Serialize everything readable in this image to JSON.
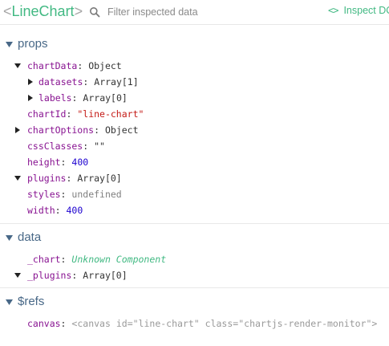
{
  "header": {
    "component_open": "<",
    "component_name": "LineChart",
    "component_close": ">",
    "search_placeholder": "Filter inspected data",
    "inspect_icon": "<>",
    "inspect_label": "Inspect DO"
  },
  "props": {
    "title": "props",
    "rows": {
      "chartData": {
        "key": "chartData",
        "value": "Object"
      },
      "datasets": {
        "key": "datasets",
        "value": "Array[1]"
      },
      "labels": {
        "key": "labels",
        "value": "Array[0]"
      },
      "chartId": {
        "key": "chartId",
        "value": "\"line-chart\""
      },
      "chartOptions": {
        "key": "chartOptions",
        "value": "Object"
      },
      "cssClasses": {
        "key": "cssClasses",
        "value": "\"\""
      },
      "height": {
        "key": "height",
        "value": "400"
      },
      "plugins": {
        "key": "plugins",
        "value": "Array[0]"
      },
      "styles": {
        "key": "styles",
        "value": "undefined"
      },
      "width": {
        "key": "width",
        "value": "400"
      }
    }
  },
  "data": {
    "title": "data",
    "rows": {
      "chart": {
        "key": "_chart",
        "value": "Unknown Component"
      },
      "plugins": {
        "key": "_plugins",
        "value": "Array[0]"
      }
    }
  },
  "refs": {
    "title": "$refs",
    "canvas": {
      "key": "canvas",
      "open": "<canvas",
      "attr1_name": "id",
      "attr1_value": "\"line-chart\"",
      "attr2_name": "class",
      "attr2_value": "\"chartjs-render-monitor\"",
      "close": ">"
    }
  },
  "colon": ":",
  "equals": "=",
  "icons": {
    "search": "search-icon",
    "arrow_down": "caret-down-icon",
    "arrow_right": "caret-right-icon"
  },
  "colors": {
    "accent": "#42b983",
    "section_title": "#486887",
    "key": "#881391",
    "string": "#c41a16",
    "number": "#1c00cf"
  }
}
